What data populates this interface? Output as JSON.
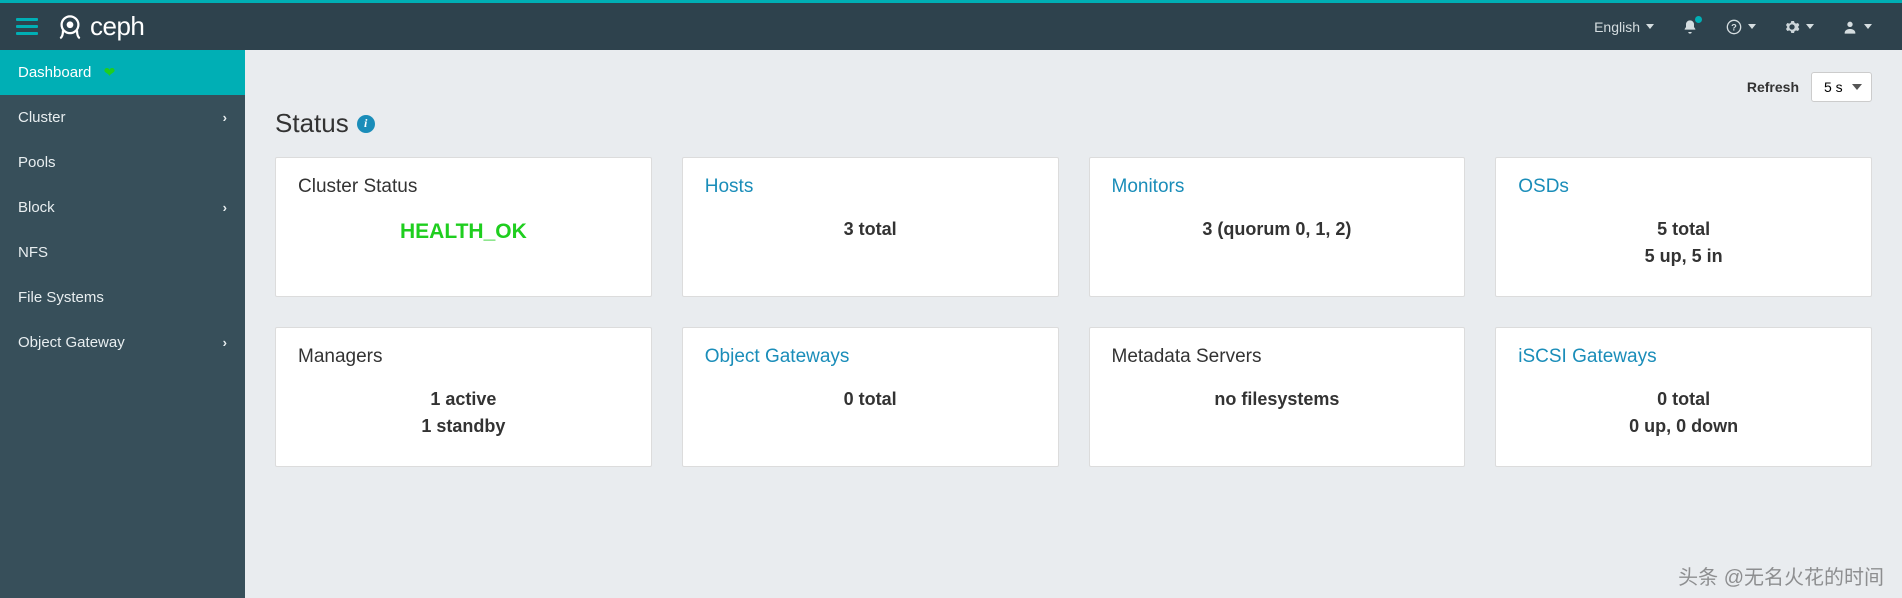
{
  "topbar": {
    "brand": "ceph",
    "language": "English"
  },
  "sidebar": {
    "items": [
      {
        "label": "Dashboard",
        "active": true,
        "heart": true,
        "expandable": false
      },
      {
        "label": "Cluster",
        "active": false,
        "expandable": true
      },
      {
        "label": "Pools",
        "active": false,
        "expandable": false
      },
      {
        "label": "Block",
        "active": false,
        "expandable": true
      },
      {
        "label": "NFS",
        "active": false,
        "expandable": false
      },
      {
        "label": "File Systems",
        "active": false,
        "expandable": false
      },
      {
        "label": "Object Gateway",
        "active": false,
        "expandable": true
      }
    ]
  },
  "refresh": {
    "label": "Refresh",
    "selected": "5 s"
  },
  "section": {
    "title": "Status"
  },
  "cards": {
    "cluster_status": {
      "title": "Cluster Status",
      "value": "HEALTH_OK"
    },
    "hosts": {
      "title": "Hosts",
      "value": "3 total"
    },
    "monitors": {
      "title": "Monitors",
      "value": "3 (quorum 0, 1, 2)"
    },
    "osds": {
      "title": "OSDs",
      "line1": "5 total",
      "line2": "5 up, 5 in"
    },
    "managers": {
      "title": "Managers",
      "line1": "1 active",
      "line2": "1 standby"
    },
    "object_gateways": {
      "title": "Object Gateways",
      "value": "0 total"
    },
    "metadata_servers": {
      "title": "Metadata Servers",
      "value": "no filesystems"
    },
    "iscsi_gateways": {
      "title": "iSCSI Gateways",
      "line1": "0 total",
      "line2": "0 up, 0 down"
    }
  },
  "watermark": "头条 @无名火花的时间"
}
